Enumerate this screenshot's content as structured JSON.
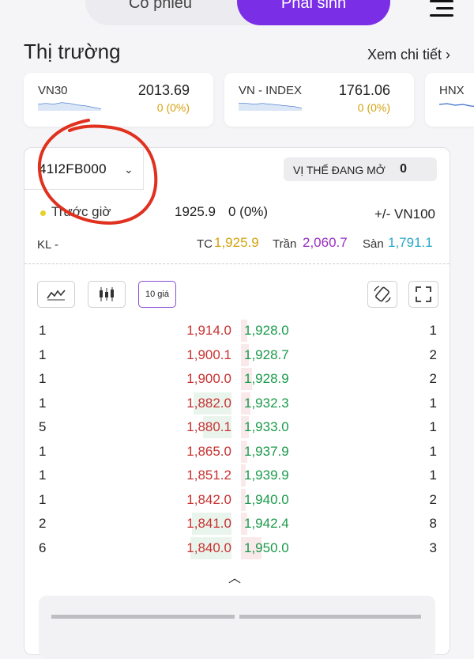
{
  "top_tabs": [
    {
      "label": "Cổ phiếu",
      "active": false
    },
    {
      "label": "Phái sinh",
      "active": true
    }
  ],
  "market": {
    "title": "Thị trường",
    "see_more": "Xem chi tiết ›",
    "indices": [
      {
        "name": "VN30",
        "value": "2013.69",
        "change": "0 (0%)"
      },
      {
        "name": "VN - INDEX",
        "value": "1761.06",
        "change": "0 (0%)"
      },
      {
        "name": "HNX",
        "value": "",
        "change": ""
      }
    ]
  },
  "contract": {
    "symbol": "41I2FB000",
    "open_position_label": "VỊ THẾ ĐANG MỞ",
    "open_position_value": "0",
    "status": "Trước giờ",
    "price": "1925.9",
    "change": "0 (0%)",
    "basis_label": "+/- VN100",
    "volume_label": "KL",
    "volume_value": "-",
    "reference_label": "TC",
    "reference_value": "1,925.9",
    "ceiling_label": "Trần",
    "ceiling_value": "2,060.7",
    "floor_label": "Sàn",
    "floor_value": "1,791.1"
  },
  "toolbar": {
    "depth_label": "10 giá"
  },
  "order_book": [
    {
      "bid_vol": "1",
      "bid": "1,914.0",
      "ask": "1,928.0",
      "ask_vol": "1"
    },
    {
      "bid_vol": "1",
      "bid": "1,900.1",
      "ask": "1,928.7",
      "ask_vol": "2"
    },
    {
      "bid_vol": "1",
      "bid": "1,900.0",
      "ask": "1,928.9",
      "ask_vol": "2"
    },
    {
      "bid_vol": "1",
      "bid": "1,882.0",
      "ask": "1,932.3",
      "ask_vol": "1"
    },
    {
      "bid_vol": "5",
      "bid": "1,880.1",
      "ask": "1,933.0",
      "ask_vol": "1"
    },
    {
      "bid_vol": "1",
      "bid": "1,865.0",
      "ask": "1,937.9",
      "ask_vol": "1"
    },
    {
      "bid_vol": "1",
      "bid": "1,851.2",
      "ask": "1,939.9",
      "ask_vol": "1"
    },
    {
      "bid_vol": "1",
      "bid": "1,842.0",
      "ask": "1,940.0",
      "ask_vol": "2"
    },
    {
      "bid_vol": "2",
      "bid": "1,841.0",
      "ask": "1,942.4",
      "ask_vol": "8"
    },
    {
      "bid_vol": "6",
      "bid": "1,840.0",
      "ask": "1,950.0",
      "ask_vol": "3"
    }
  ],
  "colors": {
    "accent": "#7a2ee6",
    "bid": "#c83232",
    "ask": "#1a9a4a",
    "reference": "#d4a20e",
    "ceiling": "#9a2fc0",
    "floor": "#2aa7c8",
    "annotation": "#e0301e"
  }
}
